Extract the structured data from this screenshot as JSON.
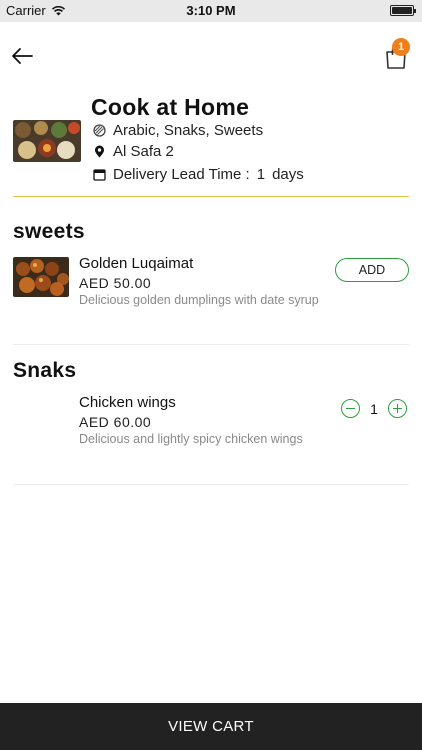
{
  "status_bar": {
    "carrier": "Carrier",
    "time": "3:10 PM"
  },
  "header": {
    "cart_count": "1"
  },
  "restaurant": {
    "name": "Cook at Home",
    "cuisines": "Arabic, Snaks, Sweets",
    "location": "Al Safa 2",
    "lead_time_label": "Delivery Lead Time :",
    "lead_time_value": "1",
    "lead_time_unit": "days"
  },
  "sections": [
    {
      "title": "sweets",
      "items": [
        {
          "name": "Golden Luqaimat",
          "price": "AED 50.00",
          "description": "Delicious golden dumplings with date syrup",
          "action_label": "ADD"
        }
      ]
    },
    {
      "title": "Snaks",
      "items": [
        {
          "name": "Chicken wings",
          "price": "AED 60.00",
          "description": "Delicious and lightly spicy chicken wings",
          "quantity": "1"
        }
      ]
    }
  ],
  "footer": {
    "view_cart_label": "VIEW CART"
  },
  "colors": {
    "accent_green": "#2e9e3e",
    "badge_orange": "#f07f1a",
    "divider_yellow": "#e8c34a",
    "footer_bg": "#222222"
  },
  "icons": [
    "wifi-icon",
    "battery-icon",
    "back-arrow-icon",
    "shopping-bag-icon",
    "cuisine-icon",
    "location-pin-icon",
    "calendar-icon",
    "minus-icon",
    "plus-icon"
  ]
}
